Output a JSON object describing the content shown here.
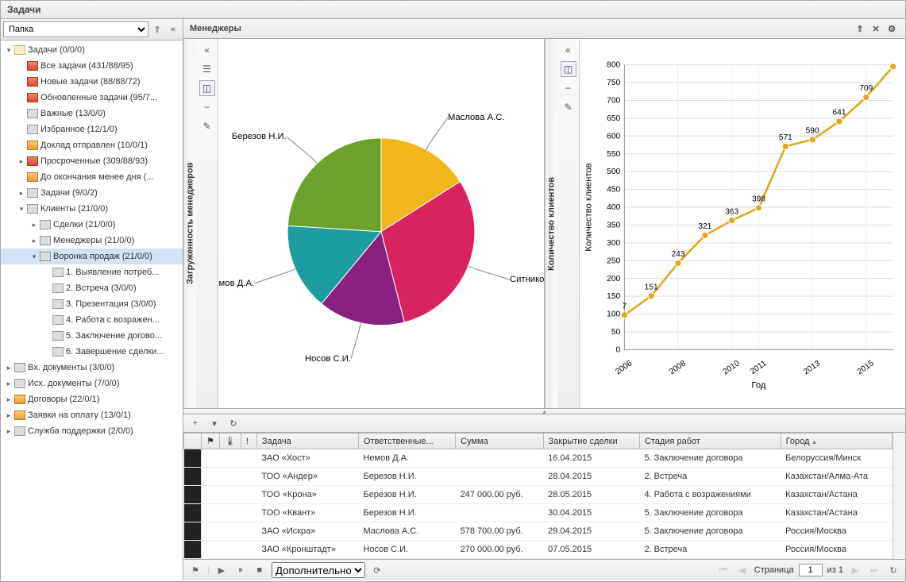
{
  "window_title": "Задачи",
  "sidebar": {
    "group_select": "Папка",
    "items": [
      {
        "depth": 0,
        "exp": "▾",
        "icon": "folder",
        "label": "Задачи (0/0/0)"
      },
      {
        "depth": 1,
        "exp": "",
        "icon": "red",
        "label": "Все задачи (431/88/95)"
      },
      {
        "depth": 1,
        "exp": "",
        "icon": "red",
        "label": "Новые задачи (88/88/72)"
      },
      {
        "depth": 1,
        "exp": "",
        "icon": "red",
        "label": "Обновленные задачи (95/7..."
      },
      {
        "depth": 1,
        "exp": "",
        "icon": "gray",
        "label": "Важные (13/0/0)"
      },
      {
        "depth": 1,
        "exp": "",
        "icon": "gray",
        "label": "Избранное (12/1/0)"
      },
      {
        "depth": 1,
        "exp": "",
        "icon": "orange",
        "label": "Доклад отправлен (10/0/1)"
      },
      {
        "depth": 1,
        "exp": "▸",
        "icon": "red",
        "label": "Просроченные (309/88/93)"
      },
      {
        "depth": 1,
        "exp": "",
        "icon": "orange",
        "label": "До окончания менее дня (..."
      },
      {
        "depth": 1,
        "exp": "▸",
        "icon": "gray",
        "label": "Задачи (9/0/2)"
      },
      {
        "depth": 1,
        "exp": "▾",
        "icon": "gray",
        "label": "Клиенты (21/0/0)"
      },
      {
        "depth": 2,
        "exp": "▸",
        "icon": "gray",
        "label": "Сделки (21/0/0)"
      },
      {
        "depth": 2,
        "exp": "▸",
        "icon": "gray",
        "label": "Менеджеры (21/0/0)"
      },
      {
        "depth": 2,
        "exp": "▾",
        "icon": "gray",
        "label": "Воронка продаж (21/0/0)",
        "selected": true
      },
      {
        "depth": 3,
        "exp": "",
        "icon": "gray",
        "label": "1. Выявление потреб..."
      },
      {
        "depth": 3,
        "exp": "",
        "icon": "gray",
        "label": "2. Встреча (3/0/0)"
      },
      {
        "depth": 3,
        "exp": "",
        "icon": "gray",
        "label": "3. Презентация (3/0/0)"
      },
      {
        "depth": 3,
        "exp": "",
        "icon": "gray",
        "label": "4. Работа с возражен..."
      },
      {
        "depth": 3,
        "exp": "",
        "icon": "gray",
        "label": "5. Заключение догово..."
      },
      {
        "depth": 3,
        "exp": "",
        "icon": "gray",
        "label": "6. Завершение сделки..."
      },
      {
        "depth": 0,
        "exp": "▸",
        "icon": "gray",
        "label": "Вх. документы (3/0/0)"
      },
      {
        "depth": 0,
        "exp": "▸",
        "icon": "gray",
        "label": "Исх. документы (7/0/0)"
      },
      {
        "depth": 0,
        "exp": "▸",
        "icon": "orange",
        "label": "Договоры (22/0/1)"
      },
      {
        "depth": 0,
        "exp": "▸",
        "icon": "orange",
        "label": "Заявки на оплату (13/0/1)"
      },
      {
        "depth": 0,
        "exp": "▸",
        "icon": "gray",
        "label": "Служба поддержки (2/0/0)"
      }
    ]
  },
  "main_header": "Менеджеры",
  "chart_data": [
    {
      "type": "pie",
      "panel_title": "Загруженность менеджеров",
      "slices": [
        {
          "label": "Маслова А.С.",
          "value": 16,
          "color": "#f2b61b"
        },
        {
          "label": "Ситников А.А.",
          "value": 30,
          "color": "#d8235f"
        },
        {
          "label": "Носов С.И.",
          "value": 15,
          "color": "#8a2180"
        },
        {
          "label": "Немов Д.А.",
          "value": 15,
          "color": "#1e9da0"
        },
        {
          "label": "Березов Н.И.",
          "value": 24,
          "color": "#6aa22c"
        }
      ]
    },
    {
      "type": "line",
      "panel_title": "Количество клиентов",
      "xlabel": "Год",
      "ylabel": "Количество клиентов",
      "ylim": [
        0,
        800
      ],
      "yticks": [
        0,
        50,
        100,
        150,
        200,
        250,
        300,
        350,
        400,
        450,
        500,
        550,
        600,
        650,
        700,
        750,
        800
      ],
      "x": [
        "2006",
        "2007",
        "2008",
        "2009",
        "2010",
        "2011",
        "2012",
        "2013",
        "2014",
        "2015",
        "2016"
      ],
      "xticks": [
        "2006",
        "2008",
        "2010",
        "2011",
        "2013",
        "2015"
      ],
      "values": [
        97,
        151,
        243,
        321,
        363,
        398,
        571,
        590,
        641,
        709,
        795
      ],
      "point_labels": [
        "7",
        "151",
        "243",
        "321",
        "363",
        "398",
        "571",
        "590",
        "641",
        "709",
        ""
      ],
      "color": "#e0a71a"
    }
  ],
  "grid_toolbar": {
    "add": "+",
    "dropdown": "▾",
    "refresh": "↻"
  },
  "columns": {
    "flag": "",
    "therm": "",
    "bang": "!",
    "task": "Задача",
    "resp": "Ответственные...",
    "sum": "Сумма",
    "close": "Закрытие сделки",
    "stage": "Стадия работ",
    "city": "Город"
  },
  "rows": [
    {
      "task": "ЗАО «Хост»",
      "resp": "Немов Д.А.",
      "sum": "",
      "close": "16.04.2015",
      "stage": "5. Заключение договора",
      "city": "Белоруссия/Минск"
    },
    {
      "task": "ТОО «Андер»",
      "resp": "Березов Н.И.",
      "sum": "",
      "close": "28.04.2015",
      "stage": "2. Встреча",
      "city": "Казахстан/Алма-Ата"
    },
    {
      "task": "ТОО «Крона»",
      "resp": "Березов Н.И.",
      "sum": "247 000.00 руб.",
      "close": "28.05.2015",
      "stage": "4. Работа с возражениями",
      "city": "Казахстан/Астана"
    },
    {
      "task": "ТОО «Квант»",
      "resp": "Березов Н.И.",
      "sum": "",
      "close": "30.04.2015",
      "stage": "5. Заключение договора",
      "city": "Казахстан/Астана"
    },
    {
      "task": "ЗАО «Искра»",
      "resp": "Маслова А.С.",
      "sum": "578 700.00 руб.",
      "close": "29.04.2015",
      "stage": "5. Заключение договора",
      "city": "Россия/Москва"
    },
    {
      "task": "ЗАО «Кронштадт»",
      "resp": "Носов С.И.",
      "sum": "270 000.00 руб.",
      "close": "07.05.2015",
      "stage": "2. Встреча",
      "city": "Россия/Москва"
    }
  ],
  "paginator": {
    "extra_select": "Дополнительно",
    "page_label": "Страница",
    "page": "1",
    "of_label": "из 1"
  }
}
